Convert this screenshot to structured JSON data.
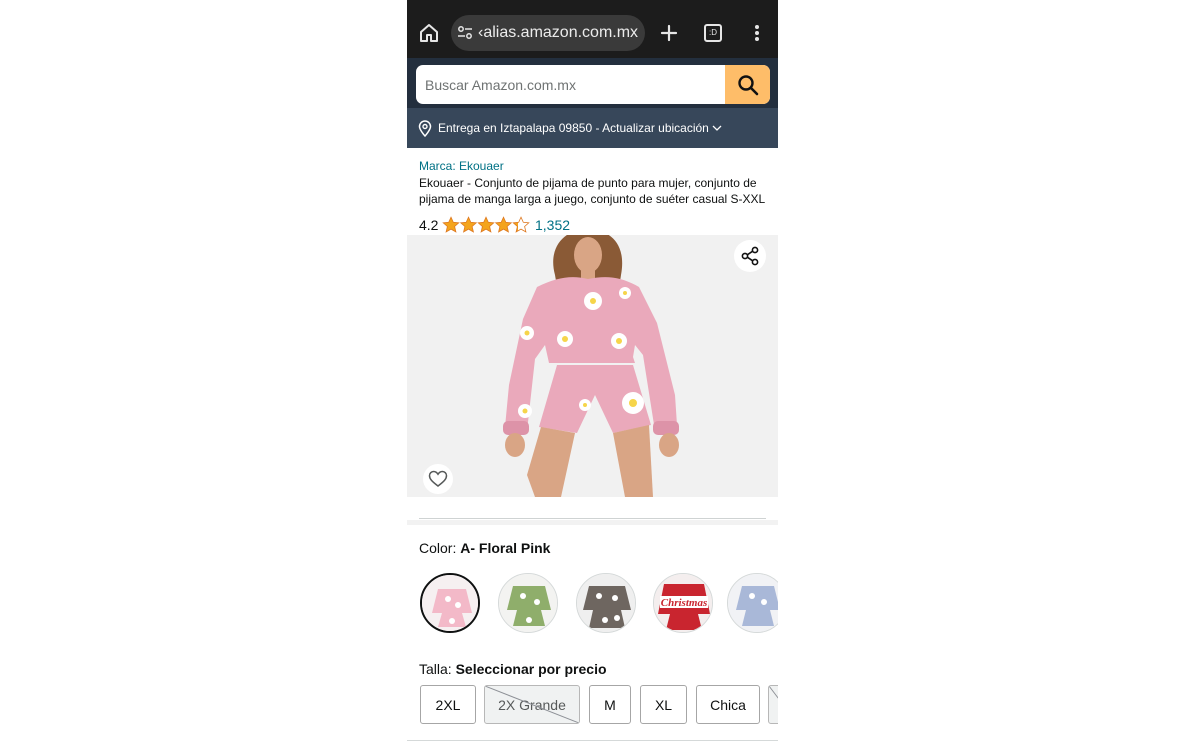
{
  "browser": {
    "url": "‹alias.amazon.com.mx",
    "tab_icon_text": ":D"
  },
  "search": {
    "placeholder": "Buscar Amazon.com.mx"
  },
  "delivery": {
    "text": "Entrega en Iztapalapa 09850 - Actualizar ubicación"
  },
  "product": {
    "brand": "Marca: Ekouaer",
    "title": "Ekouaer - Conjunto de pijama de punto para mujer, conjunto de pijama de manga larga a juego, conjunto de suéter casual S-XXL",
    "rating": "4.2",
    "rating_value": 4.2,
    "review_count": "1,352"
  },
  "color": {
    "label": "Color: ",
    "selected": "A- Floral Pink",
    "swatches": [
      {
        "name": "floral-pink",
        "bg": "#f3b9c8",
        "selected": true
      },
      {
        "name": "floral-green",
        "bg": "#8fae6b",
        "selected": false
      },
      {
        "name": "floral-gray",
        "bg": "#6e6660",
        "selected": false
      },
      {
        "name": "christmas-red",
        "bg": "#c9252f",
        "text": "Christmas",
        "selected": false
      },
      {
        "name": "floral-blue",
        "bg": "#a9b8d8",
        "selected": false
      }
    ]
  },
  "size": {
    "label": "Talla: ",
    "selected": "Seleccionar por precio",
    "options": [
      {
        "label": "2XL",
        "available": true
      },
      {
        "label": "2X Grande",
        "available": false
      },
      {
        "label": "M",
        "available": true
      },
      {
        "label": "XL",
        "available": true
      },
      {
        "label": "Chica",
        "available": true
      }
    ]
  },
  "colors": {
    "amazon_dark": "#232f3e",
    "delivery_bar": "#37475a",
    "search_button": "#febd69",
    "link": "#007185",
    "star": "#f4a41c"
  },
  "icons": [
    "home-icon",
    "tune-icon",
    "plus-icon",
    "tabs-icon",
    "menu-icon",
    "search-icon",
    "location-pin-icon",
    "chevron-down-icon",
    "share-icon",
    "heart-icon",
    "star-icon"
  ]
}
